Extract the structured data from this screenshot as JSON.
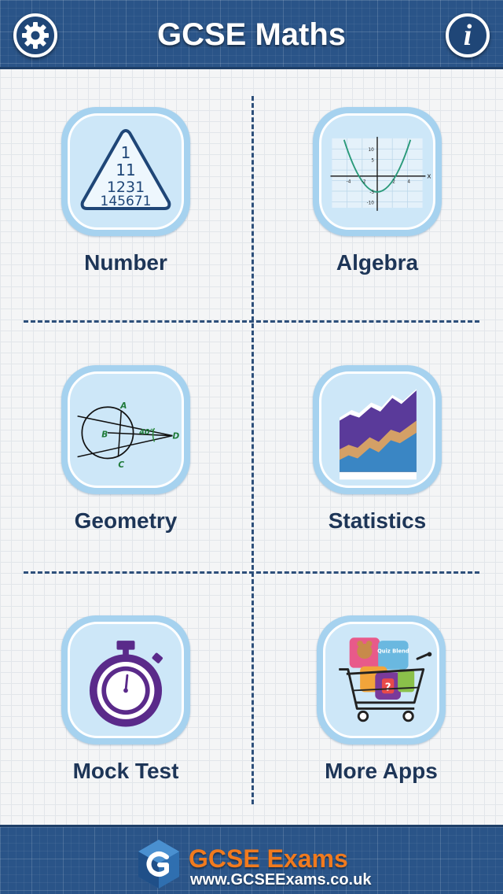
{
  "header": {
    "title": "GCSE Maths",
    "settings_icon": "gear-icon",
    "info_icon": "info-icon",
    "info_glyph": "i"
  },
  "topics": [
    {
      "label": "Number",
      "icon": "number-triangle-icon"
    },
    {
      "label": "Algebra",
      "icon": "parabola-graph-icon"
    },
    {
      "label": "Geometry",
      "icon": "circle-tangent-icon"
    },
    {
      "label": "Statistics",
      "icon": "area-chart-icon"
    },
    {
      "label": "Mock Test",
      "icon": "stopwatch-icon"
    },
    {
      "label": "More Apps",
      "icon": "shopping-cart-icon"
    }
  ],
  "number_icon": {
    "rows": [
      "1",
      "11",
      "1231",
      "145671"
    ]
  },
  "algebra_icon": {
    "x_label": "x",
    "x_ticks": [
      "-4",
      "-2",
      "2",
      "4"
    ],
    "y_ticks": [
      "10",
      "5",
      "-5",
      "-10"
    ]
  },
  "geometry_icon": {
    "points": [
      "A",
      "B",
      "C",
      "D"
    ],
    "angle": "40°"
  },
  "more_apps_icon": {
    "caption": "Quiz Blend"
  },
  "footer": {
    "brand_name": "GCSE Exams",
    "url": "www.GCSEExams.co.uk"
  },
  "colors": {
    "header_bg": "#2a5488",
    "label_text": "#1d3557",
    "tile_bg": "#a6d2ef",
    "brand_orange": "#f07a1e"
  }
}
